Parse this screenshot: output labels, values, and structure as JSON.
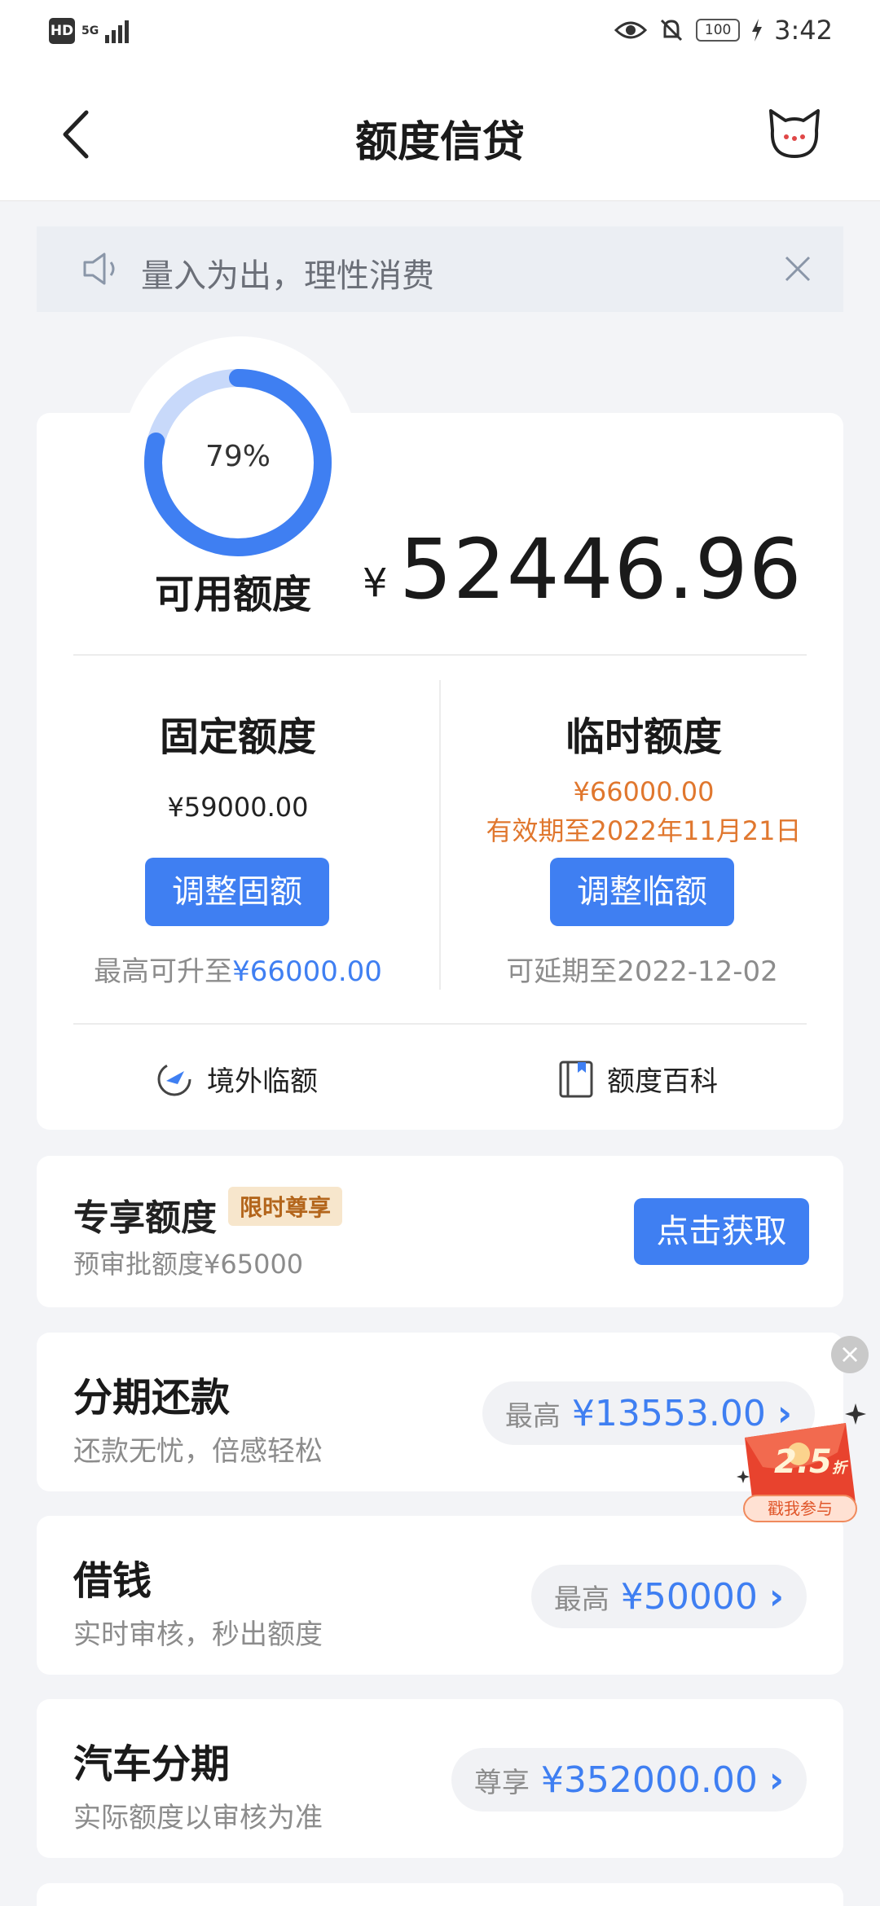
{
  "status_bar": {
    "hd": "HD",
    "network": "5G",
    "time": "3:42",
    "battery": "100",
    "icons": [
      "eye-icon",
      "bell-off-icon",
      "charging-icon"
    ]
  },
  "header": {
    "title": "额度信贷",
    "back_icon": "chevron-left-icon",
    "mascot_icon": "cat-mascot-icon"
  },
  "notice": {
    "text": "量入为出，理性消费",
    "icon": "speaker-icon",
    "close_icon": "close-icon"
  },
  "credit": {
    "used_percent_label": "79%",
    "available_fraction": 0.79,
    "available_label": "可用额度",
    "currency": "¥",
    "available_amount": "52446.96"
  },
  "fixed": {
    "title": "固定额度",
    "amount": "¥59000.00",
    "button": "调整固额",
    "note_prefix": "最高可升至",
    "note_highlight": "¥66000.00"
  },
  "temporary": {
    "title": "临时额度",
    "amount": "¥66000.00",
    "valid": "有效期至2022年11月21日",
    "button": "调整临额",
    "note": "可延期至2022-12-02"
  },
  "links": {
    "overseas": "境外临额",
    "wiki": "额度百科"
  },
  "exclusive": {
    "title": "专享额度",
    "badge": "限时尊享",
    "subtitle": "预审批额度¥65000",
    "button": "点击获取"
  },
  "products": [
    {
      "title": "分期还款",
      "subtitle": "还款无忧，倍感轻松",
      "pill_label": "最高",
      "pill_value": "¥13553.00"
    },
    {
      "title": "借钱",
      "subtitle": "实时审核，秒出额度",
      "pill_label": "最高",
      "pill_value": "¥50000"
    },
    {
      "title": "汽车分期",
      "subtitle": "实际额度以审核为准",
      "pill_label": "尊享",
      "pill_value": "¥352000.00"
    }
  ],
  "promo": {
    "discount": "2.5",
    "discount_unit": "折",
    "cta": "戳我参与"
  },
  "colors": {
    "accent": "#3f7ff2",
    "warning": "#e0772e",
    "background": "#f3f4f7"
  }
}
